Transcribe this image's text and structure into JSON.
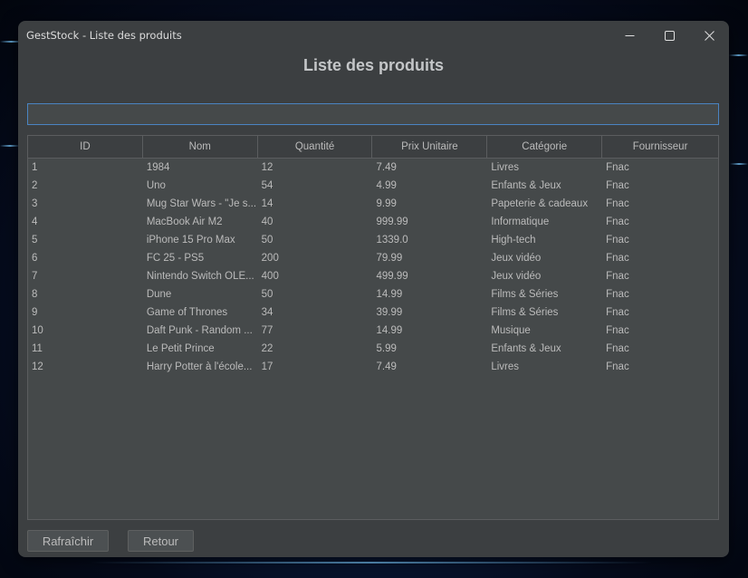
{
  "window": {
    "title": "GestStock - Liste des produits"
  },
  "heading": "Liste des produits",
  "search": {
    "value": "",
    "placeholder": ""
  },
  "table": {
    "columns": [
      "ID",
      "Nom",
      "Quantité",
      "Prix Unitaire",
      "Catégorie",
      "Fournisseur"
    ],
    "rows": [
      [
        "1",
        "1984",
        "12",
        "7.49",
        "Livres",
        "Fnac"
      ],
      [
        "2",
        "Uno",
        "54",
        "4.99",
        "Enfants & Jeux",
        "Fnac"
      ],
      [
        "3",
        "Mug Star Wars - \"Je s...",
        "14",
        "9.99",
        "Papeterie & cadeaux",
        "Fnac"
      ],
      [
        "4",
        "MacBook Air M2",
        "40",
        "999.99",
        "Informatique",
        "Fnac"
      ],
      [
        "5",
        "iPhone 15 Pro Max",
        "50",
        "1339.0",
        "High-tech",
        "Fnac"
      ],
      [
        "6",
        "FC 25 - PS5",
        "200",
        "79.99",
        "Jeux vidéo",
        "Fnac"
      ],
      [
        "7",
        "Nintendo Switch OLE...",
        "400",
        "499.99",
        "Jeux vidéo",
        "Fnac"
      ],
      [
        "8",
        "Dune",
        "50",
        "14.99",
        "Films & Séries",
        "Fnac"
      ],
      [
        "9",
        "Game of Thrones",
        "34",
        "39.99",
        "Films & Séries",
        "Fnac"
      ],
      [
        "10",
        "Daft Punk - Random ...",
        "77",
        "14.99",
        "Musique",
        "Fnac"
      ],
      [
        "11",
        "Le Petit Prince",
        "22",
        "5.99",
        "Enfants & Jeux",
        "Fnac"
      ],
      [
        "12",
        "Harry Potter à l'école...",
        "17",
        "7.49",
        "Livres",
        "Fnac"
      ]
    ]
  },
  "buttons": {
    "refresh": "Rafraîchir",
    "back": "Retour"
  },
  "icons": {
    "minimize": "minimize-icon",
    "maximize": "maximize-icon",
    "close": "close-icon"
  },
  "colors": {
    "window_bg": "#3c3f41",
    "table_bg": "#45494a",
    "text": "#bbbbbb",
    "focus_border": "#4a84c2"
  }
}
